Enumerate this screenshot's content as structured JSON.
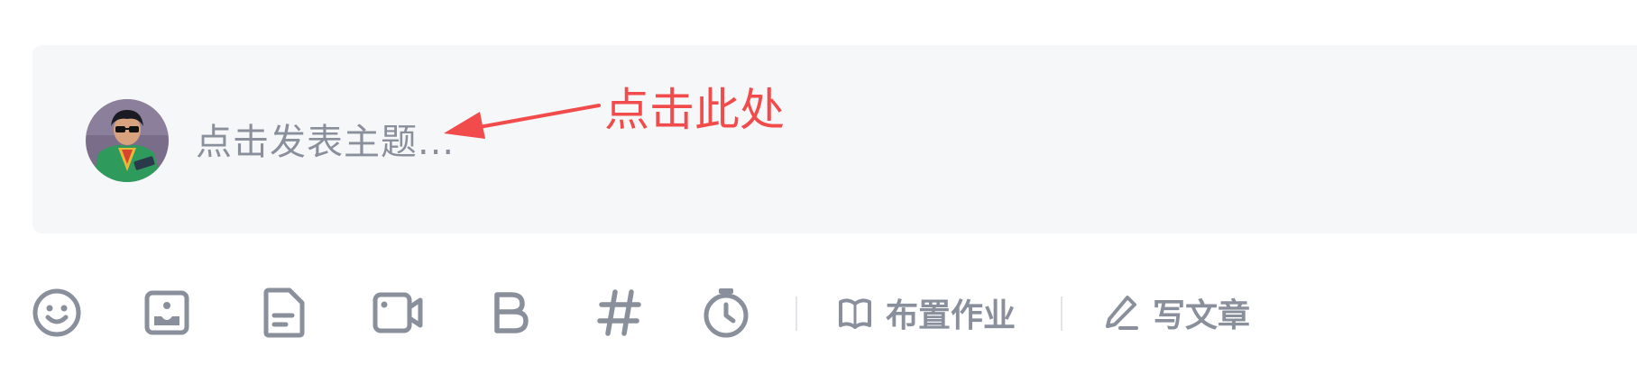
{
  "composer": {
    "placeholder": "点击发表主题..."
  },
  "annotation": {
    "text": "点击此处",
    "color": "#f24b4b"
  },
  "toolbar": {
    "icons": [
      "emoji-icon",
      "image-icon",
      "document-icon",
      "video-icon",
      "bold-icon",
      "hashtag-icon",
      "timer-icon"
    ],
    "assign_homework_label": "布置作业",
    "write_article_label": "写文章"
  },
  "colors": {
    "icon": "#8a8f9c",
    "background": "#f6f7f9"
  }
}
